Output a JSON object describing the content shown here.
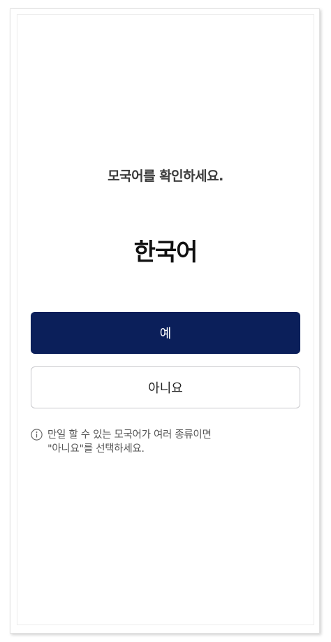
{
  "prompt": "모국어를 확인하세요.",
  "language": "한국어",
  "buttons": {
    "yes": "예",
    "no": "아니요"
  },
  "info": {
    "icon": "info-circle-icon",
    "line1": "만일 할 수 있는 모국어가 여러 종류이면",
    "line2": "\"아니요\"를 선택하세요."
  },
  "colors": {
    "primary": "#0b1f5a",
    "outline": "#c8c8cc"
  }
}
